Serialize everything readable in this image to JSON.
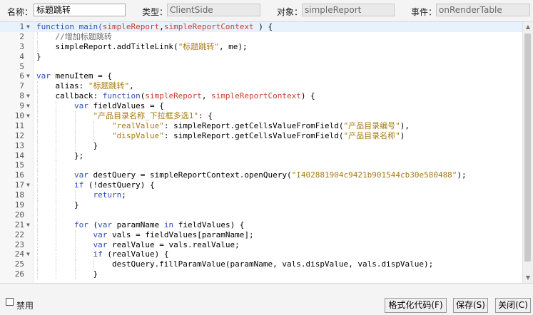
{
  "header": {
    "name_label": "名称：",
    "name_value": "标题跳转",
    "type_label": "类型：",
    "type_value": "ClientSide",
    "object_label": "对象：",
    "object_value": "simpleReport",
    "event_label": "事件：",
    "event_value": "onRenderTable"
  },
  "editor": {
    "active_line": 1,
    "lines": [
      {
        "n": "1",
        "fold": true,
        "indent": 0,
        "tokens": [
          [
            "kw",
            "function "
          ],
          [
            "fn",
            "main("
          ],
          [
            "pa",
            "simpleReport"
          ],
          [
            "",
            ","
          ],
          [
            "pa",
            "simpleReportContext"
          ],
          [
            "",
            " ) {"
          ]
        ]
      },
      {
        "n": "2",
        "fold": false,
        "indent": 1,
        "tokens": [
          [
            "cm",
            "    //增加标题跳转"
          ]
        ]
      },
      {
        "n": "3",
        "fold": false,
        "indent": 1,
        "tokens": [
          [
            "",
            "    simpleReport.addTitleLink("
          ],
          [
            "st",
            "\"标题跳转\""
          ],
          [
            "",
            ", me);"
          ]
        ]
      },
      {
        "n": "4",
        "fold": false,
        "indent": 0,
        "tokens": [
          [
            "",
            "}"
          ]
        ]
      },
      {
        "n": "5",
        "fold": false,
        "indent": 0,
        "tokens": [
          [
            "",
            ""
          ]
        ]
      },
      {
        "n": "6",
        "fold": true,
        "indent": 0,
        "tokens": [
          [
            "kw",
            "var "
          ],
          [
            "",
            "menuItem = {"
          ]
        ]
      },
      {
        "n": "7",
        "fold": false,
        "indent": 1,
        "tokens": [
          [
            "",
            "    alias: "
          ],
          [
            "st",
            "\"标题跳转\""
          ],
          [
            "",
            ","
          ]
        ]
      },
      {
        "n": "8",
        "fold": true,
        "indent": 1,
        "tokens": [
          [
            "",
            "    callback: "
          ],
          [
            "kw",
            "function"
          ],
          [
            "",
            "("
          ],
          [
            "pa",
            "simpleReport"
          ],
          [
            "",
            ", "
          ],
          [
            "pa",
            "simpleReportContext"
          ],
          [
            "",
            ") {"
          ]
        ]
      },
      {
        "n": "9",
        "fold": true,
        "indent": 2,
        "tokens": [
          [
            "",
            "        "
          ],
          [
            "kw",
            "var "
          ],
          [
            "",
            "fieldValues = {"
          ]
        ]
      },
      {
        "n": "10",
        "fold": true,
        "indent": 3,
        "tokens": [
          [
            "",
            "            "
          ],
          [
            "st",
            "\"产品目录名称_下拉框多选1\""
          ],
          [
            "",
            ": {"
          ]
        ]
      },
      {
        "n": "11",
        "fold": false,
        "indent": 4,
        "tokens": [
          [
            "",
            "                "
          ],
          [
            "st",
            "\"realValue\""
          ],
          [
            "",
            ": simpleReport.getCellsValueFromField("
          ],
          [
            "st",
            "\"产品目录编号\""
          ],
          [
            "",
            "),"
          ]
        ]
      },
      {
        "n": "12",
        "fold": false,
        "indent": 4,
        "tokens": [
          [
            "",
            "                "
          ],
          [
            "st",
            "\"dispValue\""
          ],
          [
            "",
            ": simpleReport.getCellsValueFromField("
          ],
          [
            "st",
            "\"产品目录名称\""
          ],
          [
            "",
            ")"
          ]
        ]
      },
      {
        "n": "13",
        "fold": false,
        "indent": 3,
        "tokens": [
          [
            "",
            "            }"
          ]
        ]
      },
      {
        "n": "14",
        "fold": false,
        "indent": 2,
        "tokens": [
          [
            "",
            "        };"
          ]
        ]
      },
      {
        "n": "15",
        "fold": false,
        "indent": 2,
        "tokens": [
          [
            "",
            ""
          ]
        ]
      },
      {
        "n": "16",
        "fold": false,
        "indent": 2,
        "tokens": [
          [
            "",
            "        "
          ],
          [
            "kw",
            "var "
          ],
          [
            "",
            "destQuery = simpleReportContext.openQuery("
          ],
          [
            "st",
            "\"I402881904c9421b901544cb30e580488\""
          ],
          [
            "",
            ");"
          ]
        ]
      },
      {
        "n": "17",
        "fold": true,
        "indent": 2,
        "tokens": [
          [
            "",
            "        "
          ],
          [
            "kw",
            "if "
          ],
          [
            "",
            "(!destQuery) {"
          ]
        ]
      },
      {
        "n": "18",
        "fold": false,
        "indent": 3,
        "tokens": [
          [
            "",
            "            "
          ],
          [
            "kw",
            "return"
          ],
          [
            "",
            ";"
          ]
        ]
      },
      {
        "n": "19",
        "fold": false,
        "indent": 2,
        "tokens": [
          [
            "",
            "        }"
          ]
        ]
      },
      {
        "n": "20",
        "fold": false,
        "indent": 2,
        "tokens": [
          [
            "",
            ""
          ]
        ]
      },
      {
        "n": "21",
        "fold": true,
        "indent": 2,
        "tokens": [
          [
            "",
            "        "
          ],
          [
            "kw",
            "for "
          ],
          [
            "",
            "("
          ],
          [
            "kw",
            "var "
          ],
          [
            "",
            "paramName "
          ],
          [
            "kw",
            "in "
          ],
          [
            "",
            "fieldValues) {"
          ]
        ]
      },
      {
        "n": "22",
        "fold": false,
        "indent": 3,
        "tokens": [
          [
            "",
            "            "
          ],
          [
            "kw",
            "var "
          ],
          [
            "",
            "vals = fieldValues[paramName];"
          ]
        ]
      },
      {
        "n": "23",
        "fold": false,
        "indent": 3,
        "tokens": [
          [
            "",
            "            "
          ],
          [
            "kw",
            "var "
          ],
          [
            "",
            "realValue = vals.realValue;"
          ]
        ]
      },
      {
        "n": "24",
        "fold": true,
        "indent": 3,
        "tokens": [
          [
            "",
            "            "
          ],
          [
            "kw",
            "if "
          ],
          [
            "",
            "(realValue) {"
          ]
        ]
      },
      {
        "n": "25",
        "fold": false,
        "indent": 4,
        "tokens": [
          [
            "",
            "                destQuery.fillParamValue(paramName, vals.dispValue, vals.dispValue);"
          ]
        ]
      },
      {
        "n": "26",
        "fold": false,
        "indent": 3,
        "tokens": [
          [
            "",
            "            }"
          ]
        ]
      }
    ]
  },
  "footer": {
    "disable_label": "禁用",
    "disable_checked": false,
    "format_button": "格式化代码(F)",
    "save_button": "保存(S)",
    "close_button": "关闭(C)"
  }
}
